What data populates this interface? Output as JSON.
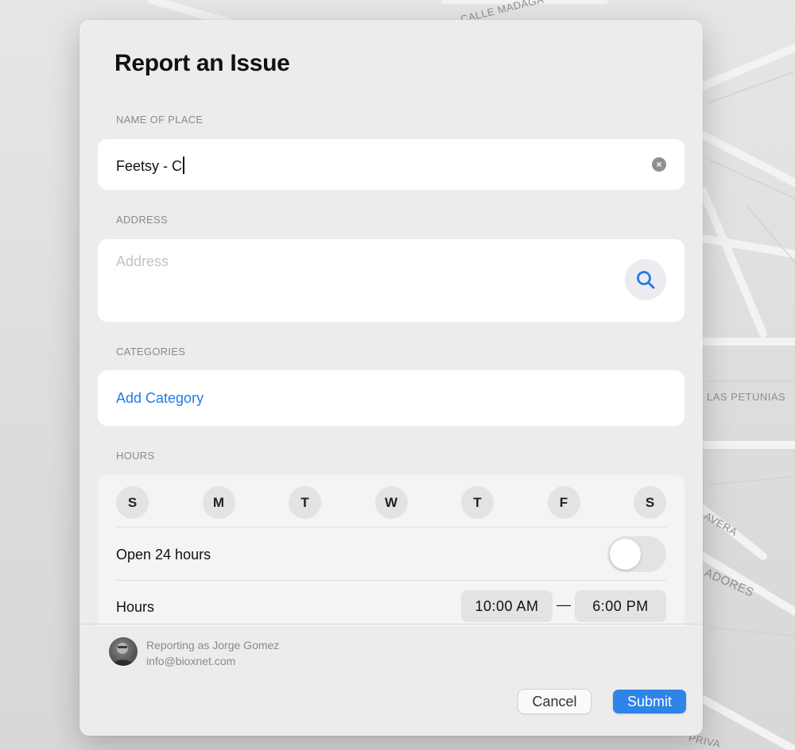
{
  "map": {
    "street_labels": {
      "calle_madaga": "CALLE MADAGA",
      "las_petunias": "LAS PETUNIAS",
      "avera": "AVERA",
      "adores": "ADORES",
      "priva": "PRIVA"
    }
  },
  "dialog": {
    "title": "Report an Issue",
    "name_section": {
      "label": "NAME OF PLACE",
      "value": "Feetsy - C"
    },
    "address_section": {
      "label": "ADDRESS",
      "placeholder": "Address"
    },
    "categories_section": {
      "label": "CATEGORIES",
      "add_label": "Add Category"
    },
    "hours_section": {
      "label": "HOURS",
      "days": [
        "S",
        "M",
        "T",
        "W",
        "T",
        "F",
        "S"
      ],
      "open_24_label": "Open 24 hours",
      "open_24_enabled": false,
      "hours_label": "Hours",
      "open_time": "10:00 AM",
      "separator": "—",
      "close_time": "6:00 PM"
    },
    "reporter": {
      "line1": "Reporting as Jorge Gomez",
      "line2": "info@bioxnet.com"
    },
    "buttons": {
      "cancel": "Cancel",
      "submit": "Submit"
    },
    "colors": {
      "accent": "#1f7be8",
      "submit_bg": "#2e84e8"
    }
  }
}
